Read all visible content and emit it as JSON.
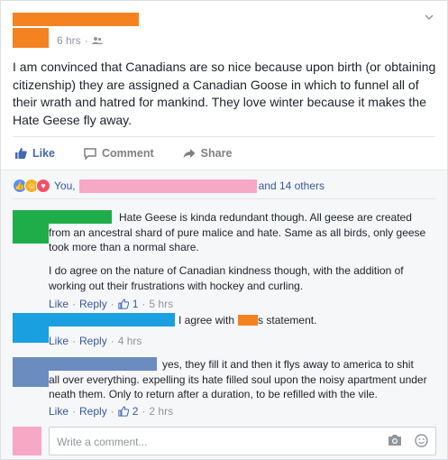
{
  "post": {
    "time": "6 hrs",
    "audience_icon": "friends-icon",
    "text": "I am convinced that Canadians are so nice because upon birth (or obtaining citizenship) they are assigned a Canadian Goose in which to funnel all of their wrath and hatred for mankind. They love winter because it makes the Hate Geese fly away."
  },
  "actions": {
    "like": "Like",
    "comment": "Comment",
    "share": "Share"
  },
  "reactions": {
    "prefix": "You,",
    "suffix": "and 14 others"
  },
  "comments": [
    {
      "text1": "Hate Geese is kinda redundant though. All geese are created from an ancestral shard of pure malice and hate. Same as all birds, only geese took more than a normal share.",
      "text2": "I do agree on the nature of Canadian kindness though, with the addition of working out their frustrations with hockey and curling.",
      "like": "Like",
      "reply": "Reply",
      "likes": "1",
      "time": "5 hrs"
    },
    {
      "text_a": "I agree with",
      "text_b": "s statement.",
      "like": "Like",
      "reply": "Reply",
      "time": "4 hrs"
    },
    {
      "text": "yes, they fill it and then it flys away to america to shit all over everything. expelling its hate filled soul upon the noisy apartment under neath them. Only to return after a duration, to be refilled with the vile.",
      "like": "Like",
      "reply": "Reply",
      "likes": "2",
      "time": "2 hrs"
    }
  ],
  "composer": {
    "placeholder": "Write a comment..."
  },
  "colors": {
    "facebook_blue": "#4267b2",
    "link_blue": "#365899",
    "redact_orange": "#f58220",
    "redact_pink": "#f7a8c4",
    "redact_green": "#1fad4a",
    "redact_blue": "#1a9fe0",
    "redact_slate": "#6b8cbf"
  }
}
